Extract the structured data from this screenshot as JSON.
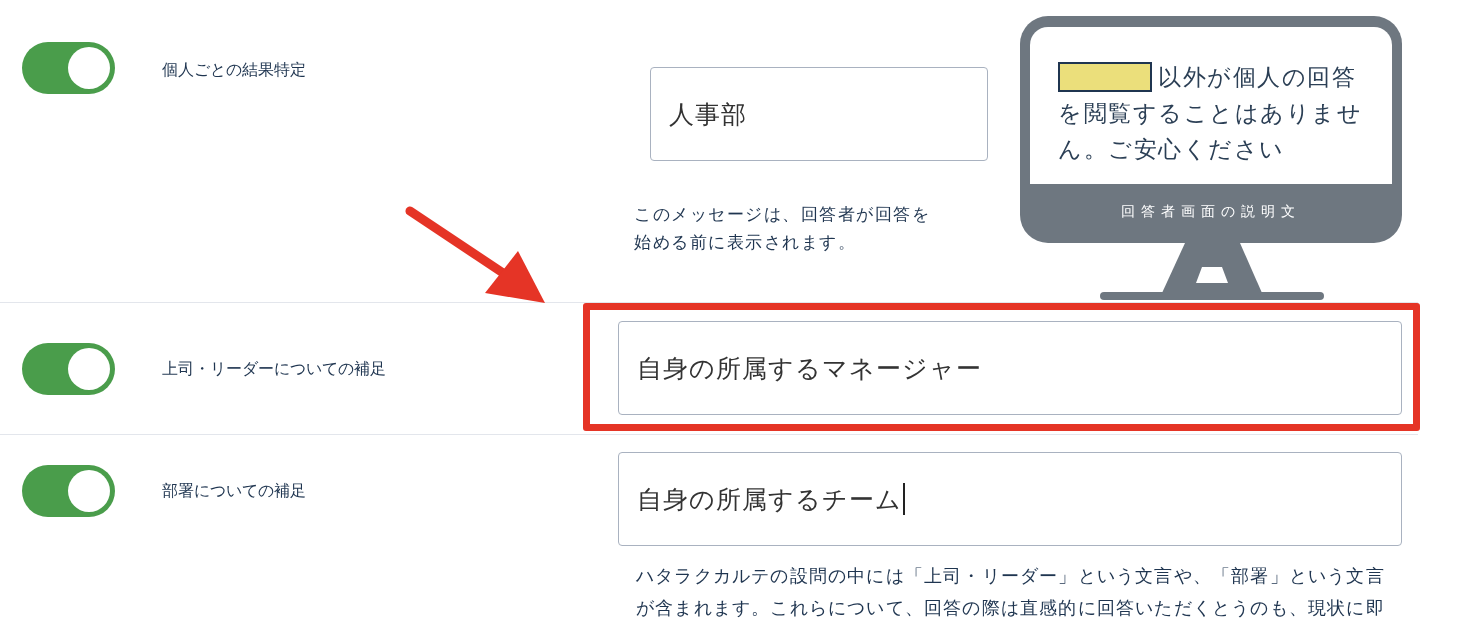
{
  "settings": [
    {
      "label": "個人ごとの結果特定",
      "on": true,
      "value": "人事部",
      "focused": false,
      "highlighted": false,
      "note": "このメッセージは、回答者が回答を始める前に表示されます。"
    },
    {
      "label": "上司・リーダーについての補足",
      "on": true,
      "value": "自身の所属するマネージャー",
      "focused": false,
      "highlighted": true
    },
    {
      "label": "部署についての補足",
      "on": true,
      "value": "自身の所属するチーム",
      "focused": true,
      "highlighted": false,
      "note": "ハタラクカルテの設問の中には「上司・リーダー」という文言や、「部署」という文言が含まれます。これらについて、回答の際は直感的に回答いただくとうのも、現状に即"
    }
  ],
  "preview": {
    "message": "以外が個人の回答を閲覧することはありません。ご安心ください",
    "caption": "回答者画面の説明文"
  }
}
